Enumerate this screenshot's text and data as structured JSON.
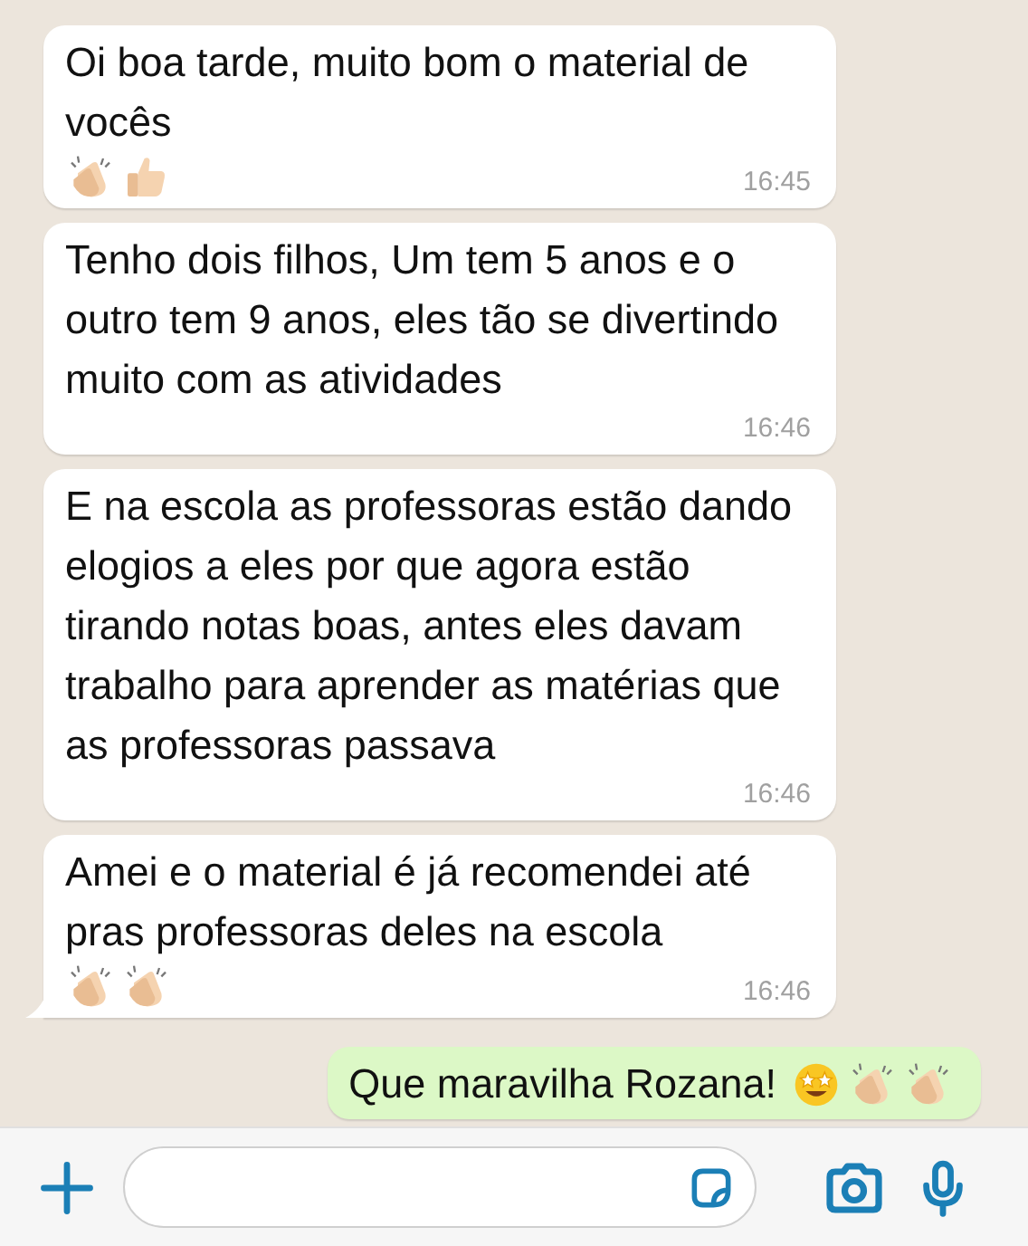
{
  "messages": [
    {
      "kind": "incoming",
      "text": "Oi boa tarde, muito bom o material de vocês",
      "emojis": [
        {
          "kind": "clap"
        },
        {
          "kind": "thumbs_up"
        }
      ],
      "time": "16:45",
      "tail": false
    },
    {
      "kind": "incoming",
      "text": "Tenho dois filhos, Um tem 5 anos e o outro tem 9 anos, eles tão se divertindo muito com as atividades",
      "time": "16:46",
      "tail": false
    },
    {
      "kind": "incoming",
      "text": "E na escola as professoras estão dando elogios a eles por que agora estão tirando notas boas, antes eles davam trabalho para aprender as matérias que as professoras passava",
      "time": "16:46",
      "tail": false
    },
    {
      "kind": "incoming",
      "text": "Amei e o material é já recomendei até pras professoras deles na escola",
      "emojis": [
        {
          "kind": "clap"
        },
        {
          "kind": "clap"
        }
      ],
      "time": "16:46",
      "tail": true
    },
    {
      "kind": "outgoing",
      "text": "Que maravilha Rozana!",
      "emojis": [
        {
          "kind": "star_struck"
        },
        {
          "kind": "clap"
        },
        {
          "kind": "clap"
        }
      ],
      "tail": false
    }
  ]
}
